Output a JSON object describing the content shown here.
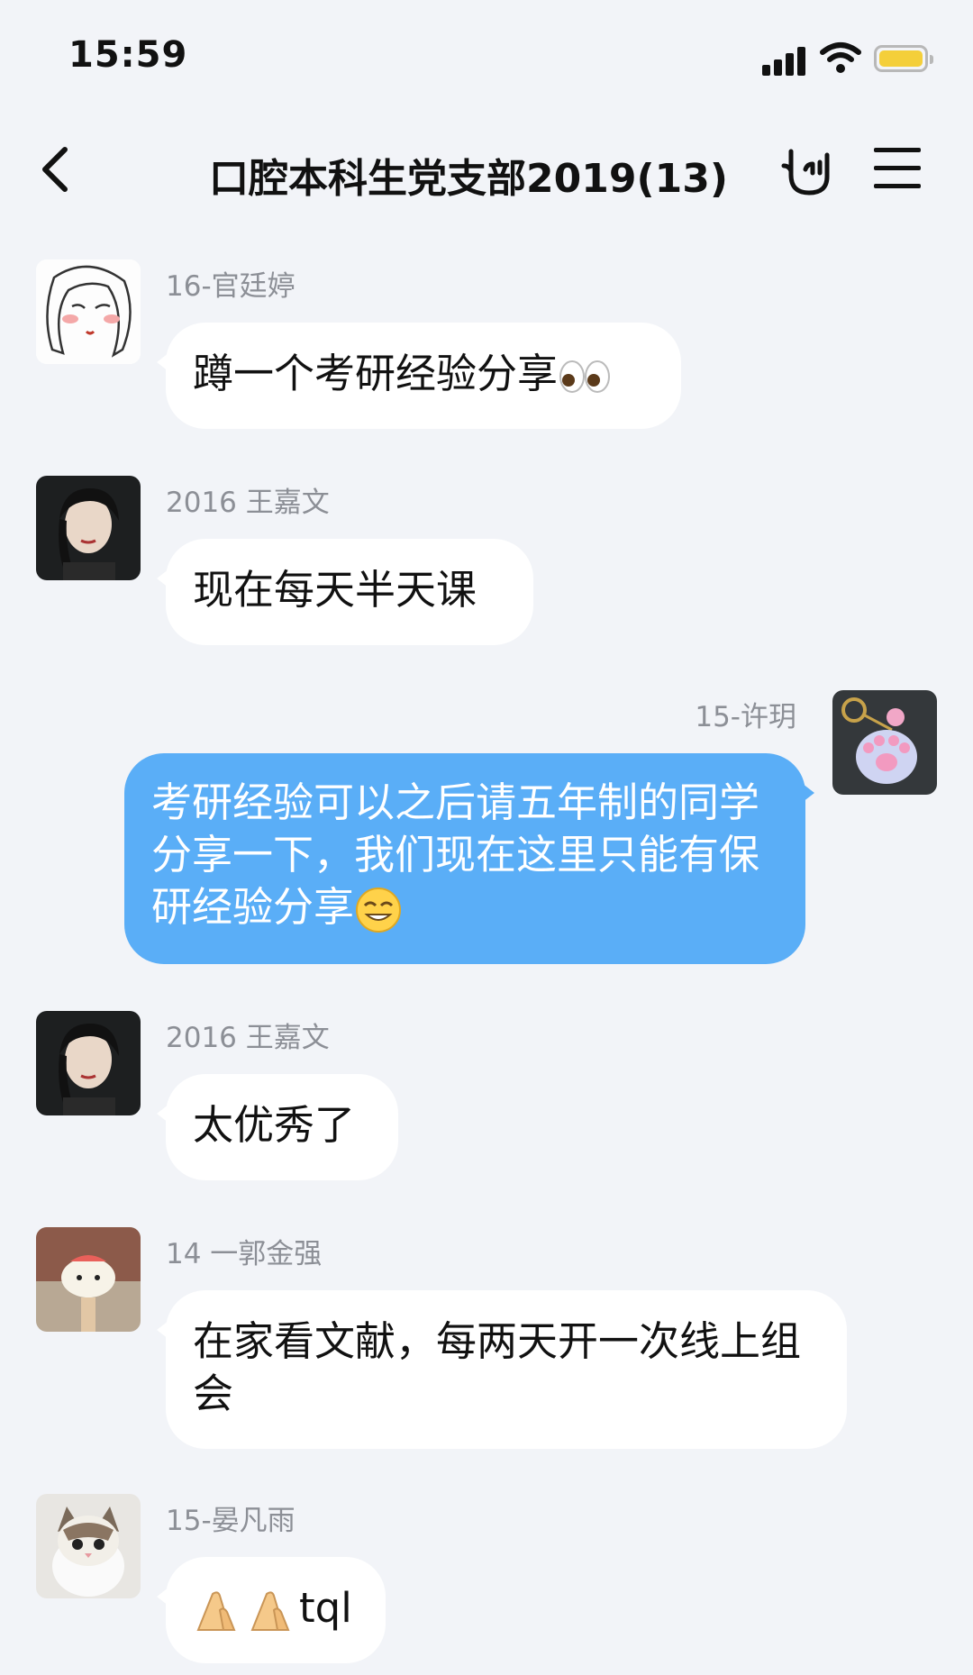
{
  "status_bar": {
    "time": "15:59"
  },
  "header": {
    "title": "口腔本科生党支部2019(13)"
  },
  "messages": [
    {
      "sender": "16-官廷婷",
      "text": "蹲一个考研经验分享",
      "emoji": "eyes-emoji",
      "self": false
    },
    {
      "sender": "2016 王嘉文",
      "text": "现在每天半天课",
      "self": false
    },
    {
      "sender": "15-许玥",
      "text": "考研经验可以之后请五年制的同学分享一下，我们现在这里只能有保研经验分享",
      "emoji": "grin-emoji",
      "self": true
    },
    {
      "sender": "2016 王嘉文",
      "text": "太优秀了",
      "self": false
    },
    {
      "sender": "14 一郭金强",
      "text": "在家看文献，每两天开一次线上组会",
      "self": false
    },
    {
      "sender": "15-晏凡雨",
      "text": "tql",
      "emoji": "clap-hands-emoji",
      "self": false
    }
  ],
  "colors": {
    "background": "#f2f4f8",
    "self_bubble": "#5aaef7",
    "bubble": "#ffffff",
    "sender": "#8c8f96"
  }
}
